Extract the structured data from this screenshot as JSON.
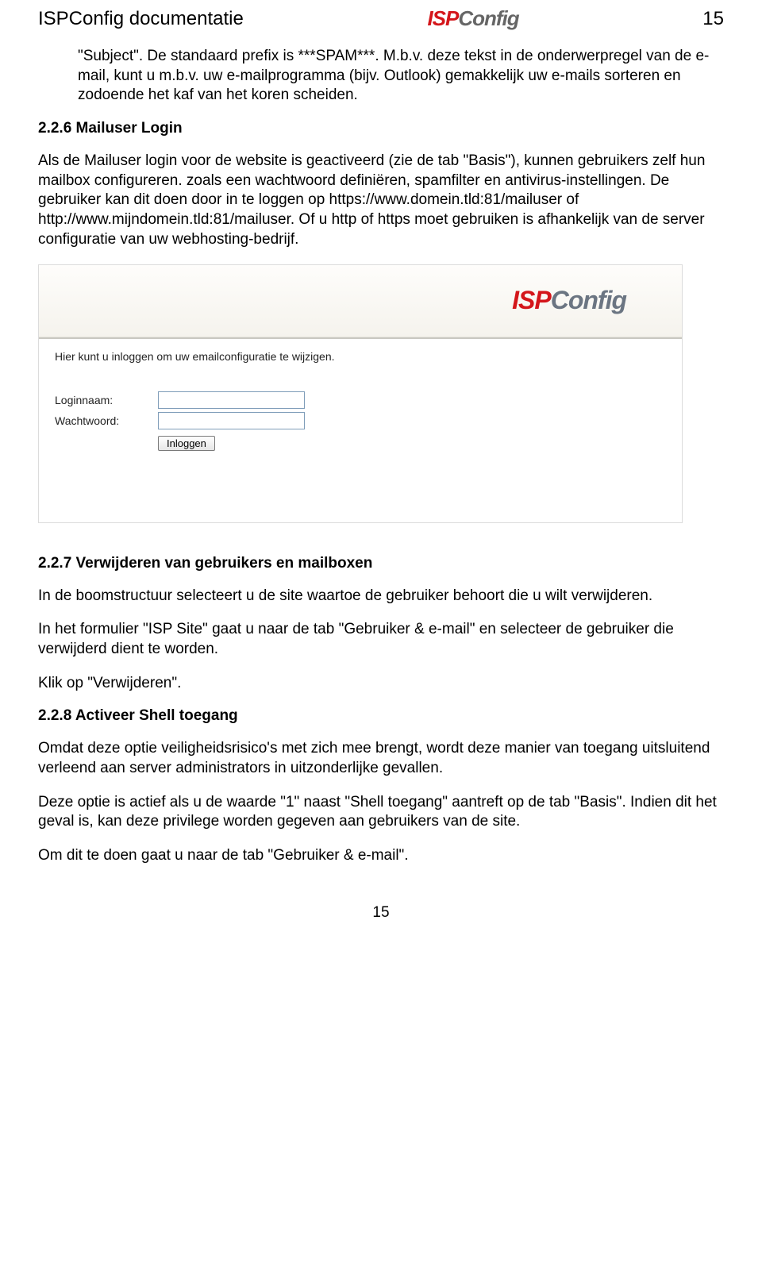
{
  "header": {
    "title": "ISPConfig documentatie",
    "logo_isp": "ISP",
    "logo_config": "Config",
    "pagenum": "15"
  },
  "intro": {
    "p1": "\"Subject\". De standaard prefix is ***SPAM***. M.b.v. deze tekst in de onderwerpregel van de e-mail, kunt u m.b.v. uw e-mailprogramma (bijv. Outlook) gemakkelijk uw e-mails sorteren en zodoende het kaf van het koren scheiden."
  },
  "sec226": {
    "heading": "2.2.6 Mailuser Login",
    "p1": "Als de Mailuser login voor de website is geactiveerd (zie de tab \"Basis\"), kunnen gebruikers zelf hun mailbox configureren. zoals een wachtwoord definiëren, spamfilter en antivirus-instellingen. De gebruiker kan dit doen door in te loggen op https://www.domein.tld:81/mailuser of http://www.mijndomein.tld:81/mailuser. Of u http of https moet gebruiken is afhankelijk van de server configuratie van uw webhosting-bedrijf."
  },
  "screenshot": {
    "logo_isp": "ISP",
    "logo_config": "Config",
    "intro": "Hier kunt u inloggen om uw emailconfiguratie te wijzigen.",
    "login_label": "Loginnaam:",
    "password_label": "Wachtwoord:",
    "login_value": "",
    "password_value": "",
    "submit_label": "Inloggen"
  },
  "sec227": {
    "heading": "2.2.7 Verwijderen van gebruikers en mailboxen",
    "p1": "In de boomstructuur selecteert u de site waartoe de gebruiker behoort die u wilt verwijderen.",
    "p2": "In het formulier \"ISP Site\" gaat u naar de tab \"Gebruiker & e-mail\" en selecteer de gebruiker die verwijderd dient te worden.",
    "p3": "Klik op \"Verwijderen\"."
  },
  "sec228": {
    "heading": "2.2.8 Activeer Shell toegang",
    "p1": "Omdat deze optie veiligheidsrisico's met zich mee brengt, wordt deze manier van toegang uitsluitend verleend aan server administrators in uitzonderlijke gevallen.",
    "p2": "Deze optie is actief als u de waarde \"1\" naast \"Shell toegang\" aantreft op de tab \"Basis\". Indien dit het geval is, kan deze privilege worden gegeven aan gebruikers van de site.",
    "p3": "Om dit te doen gaat u naar de tab \"Gebruiker & e-mail\"."
  },
  "footer": {
    "pagenum": "15"
  }
}
